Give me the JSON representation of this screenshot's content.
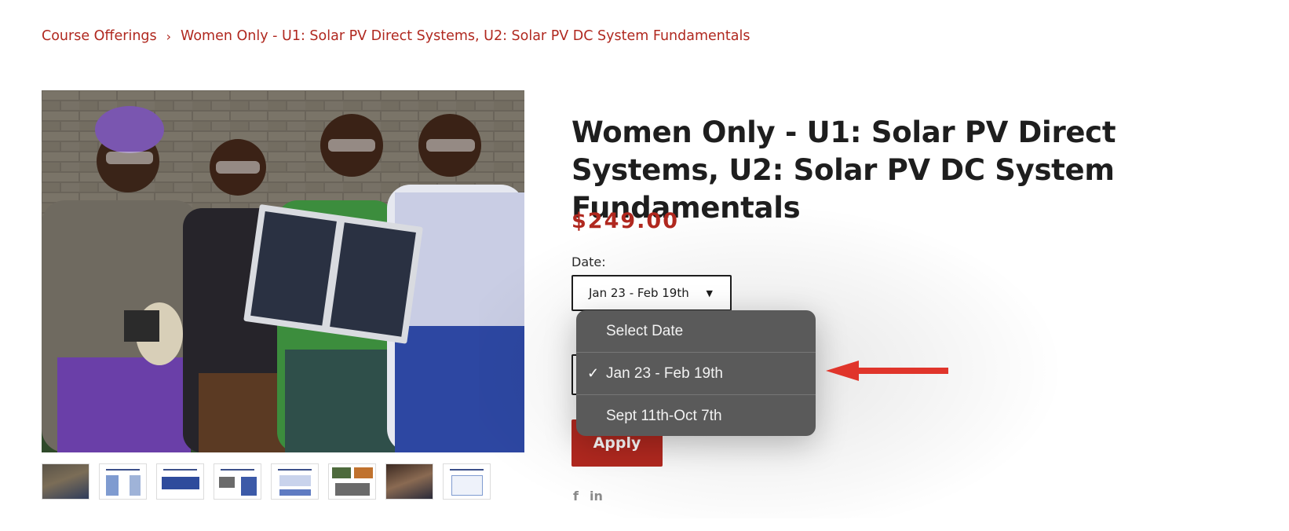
{
  "breadcrumb": {
    "root": "Course Offerings",
    "separator": "›",
    "current": "Women Only - U1: Solar PV Direct Systems, U2: Solar PV DC System Fundamentals"
  },
  "product": {
    "title": "Women Only - U1: Solar PV Direct Systems, U2: Solar PV DC System Fundamentals",
    "price": "$249.00",
    "date_label": "Date:",
    "date_selected": "Jan 23 - Feb 19th",
    "apply_label": "Apply"
  },
  "dropdown": {
    "options": [
      {
        "label": "Select Date",
        "checked": false
      },
      {
        "label": "Jan 23 - Feb 19th",
        "checked": true
      },
      {
        "label": "Sept 11th-Oct 7th",
        "checked": false
      }
    ],
    "check_glyph": "✓"
  },
  "share": {
    "facebook": "f",
    "linkedin": "in"
  },
  "colors": {
    "accent": "#b0281f",
    "dropdown_bg": "#5a5a5a",
    "arrow": "#e0352b"
  }
}
